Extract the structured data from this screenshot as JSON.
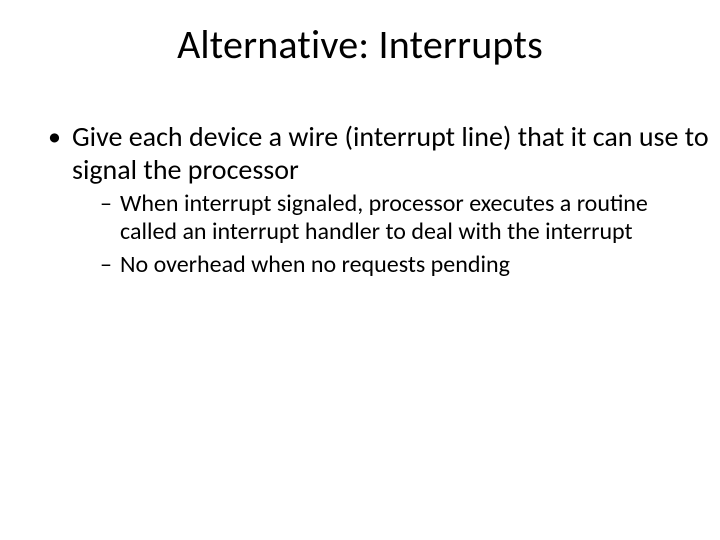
{
  "title": "Alternative: Interrupts",
  "bullets": [
    {
      "text": "Give each device a wire (interrupt line) that it can use to signal the processor",
      "sub": [
        "When interrupt signaled, processor executes a routine called an interrupt handler to deal with the interrupt",
        "No overhead when no requests pending"
      ]
    }
  ]
}
